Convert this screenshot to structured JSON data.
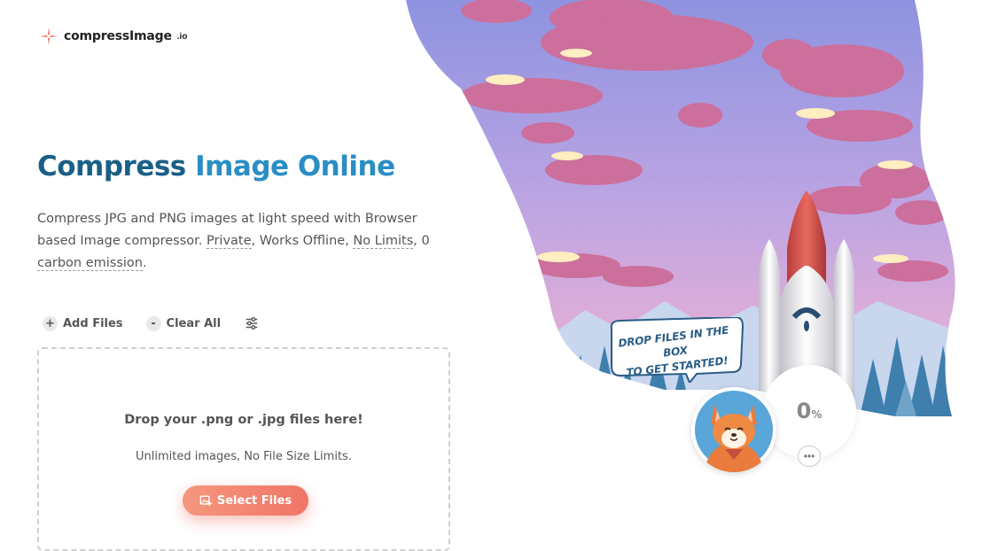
{
  "logo": {
    "name": "compressImage",
    "tld": ".io",
    "icon": "sparkle-icon",
    "accent": "#f06a5a"
  },
  "hero": {
    "title_part1": "Compress ",
    "title_part2": "Image Online",
    "desc_1": "Compress JPG and PNG images at light speed with Browser based Image compressor. ",
    "desc_private": "Private",
    "desc_2": ", Works Offline, ",
    "desc_nolimits": "No Limits",
    "desc_3": ", 0 ",
    "desc_carbon": "carbon emission",
    "desc_4": "."
  },
  "toolbar": {
    "add_files": "Add Files",
    "clear_all": "Clear All",
    "settings_icon": "sliders-icon"
  },
  "dropzone": {
    "title": "Drop your .png or .jpg files here!",
    "subtitle": "Unlimited images, No File Size Limits.",
    "button": "Select Files"
  },
  "illustration": {
    "speech_line1": "DROP FILES IN THE BOX",
    "speech_line2": "TO GET STARTED!",
    "progress_value": "0",
    "progress_unit": "%",
    "more": "•••"
  },
  "colors": {
    "title_dark": "#1a5f86",
    "title_light": "#2a8ec4",
    "button": "#f07566"
  }
}
